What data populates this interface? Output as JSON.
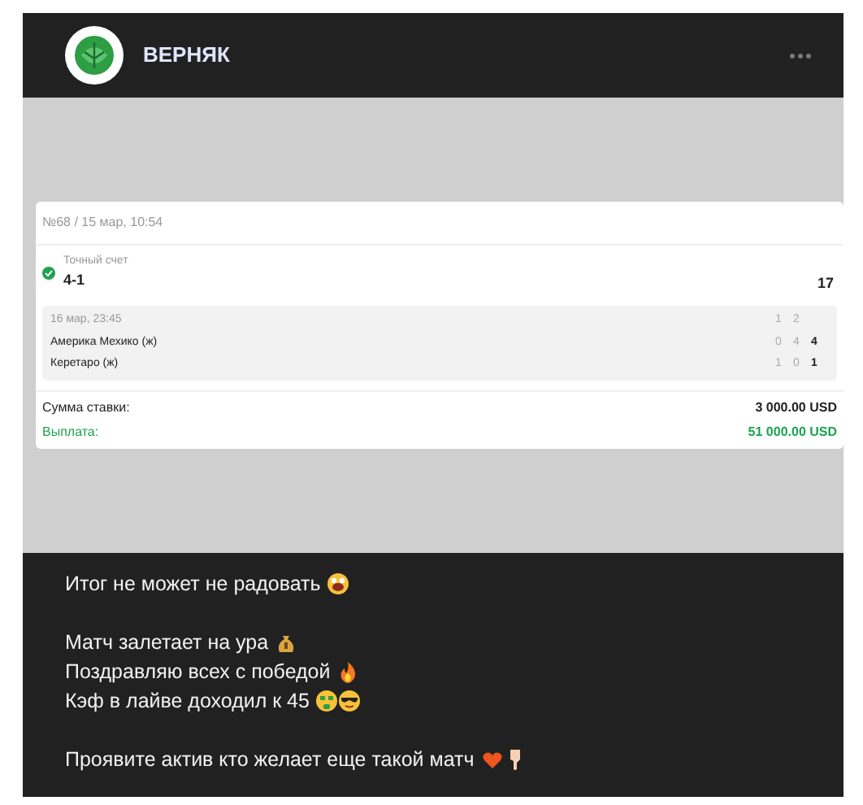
{
  "channel": {
    "name": "ВЕРНЯК"
  },
  "bet_slip": {
    "header": "№68 / 15 мар, 10:54",
    "pick": {
      "label": "Точный счет",
      "value": "4-1",
      "odds": "17",
      "won": true
    },
    "match": {
      "date": "16 мар, 23:45",
      "periods": [
        "1",
        "2"
      ],
      "teams": [
        {
          "name": "Америка Мехико (ж)",
          "scores": [
            "0",
            "4"
          ],
          "total": "4"
        },
        {
          "name": "Керетаро (ж)",
          "scores": [
            "1",
            "0"
          ],
          "total": "1"
        }
      ]
    },
    "summary": [
      {
        "kind": "stake",
        "label": "Сумма ставки:",
        "value": "3 000.00 USD"
      },
      {
        "kind": "payout",
        "label": "Выплата:",
        "value": "51 000.00 USD"
      }
    ]
  },
  "message": {
    "paragraphs": [
      [
        {
          "text": "Итог не может не радовать",
          "icons": [
            {
              "kind": "grin"
            }
          ]
        }
      ],
      [
        {
          "text": "Матч залетает на ура",
          "icons": [
            {
              "kind": "moneybag"
            }
          ]
        },
        {
          "text": "Поздравляю всех с победой",
          "icons": [
            {
              "kind": "fire"
            }
          ]
        },
        {
          "text": "Кэф в лайве доходил к 45",
          "icons": [
            {
              "kind": "moneyface"
            },
            {
              "kind": "cool"
            }
          ]
        }
      ],
      [
        {
          "text": "Проявите актив кто желает еще такой матч",
          "icons": [
            {
              "kind": "heart"
            },
            {
              "kind": "hand"
            }
          ]
        }
      ]
    ]
  }
}
